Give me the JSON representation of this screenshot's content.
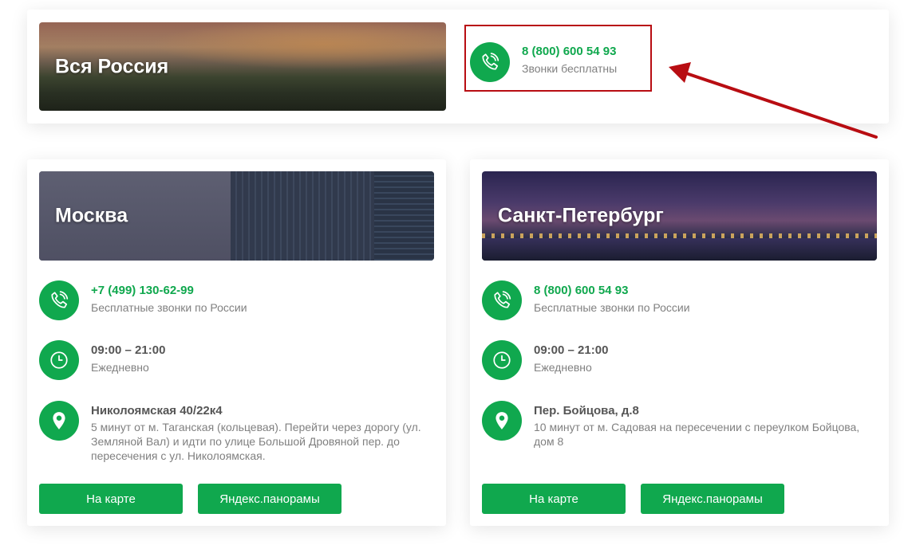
{
  "top": {
    "title": "Вся Россия",
    "phone": "8 (800) 600 54 93",
    "phone_note": "Звонки бесплатны"
  },
  "offices": [
    {
      "city": "Москва",
      "phone": "+7 (499) 130-62-99",
      "phone_note": "Бесплатные звонки по России",
      "hours": "09:00 – 21:00",
      "hours_note": "Ежедневно",
      "address": "Николоямская 40/22к4",
      "address_note": "5 минут от м. Таганская (кольцевая). Перейти через дорогу (ул. Земляной Вал) и идти по улице Большой Дровяной пер. до пересечения с ул. Николоямская.",
      "map_button": "На карте",
      "panorama_button": "Яндекс.панорамы"
    },
    {
      "city": "Санкт-Петербург",
      "phone": "8 (800) 600 54 93",
      "phone_note": "Бесплатные звонки по России",
      "hours": "09:00 – 21:00",
      "hours_note": "Ежедневно",
      "address": "Пер. Бойцова, д.8",
      "address_note": "10 минут от м. Садовая на пересечении с переулком Бойцова, дом 8",
      "map_button": "На карте",
      "panorama_button": "Яндекс.панорамы"
    }
  ],
  "icons": {
    "phone": "phone-icon",
    "clock": "clock-icon",
    "location": "location-pin-icon"
  },
  "colors": {
    "accent": "#10a84e",
    "highlight_border": "#b80d12",
    "arrow": "#b80d12"
  }
}
